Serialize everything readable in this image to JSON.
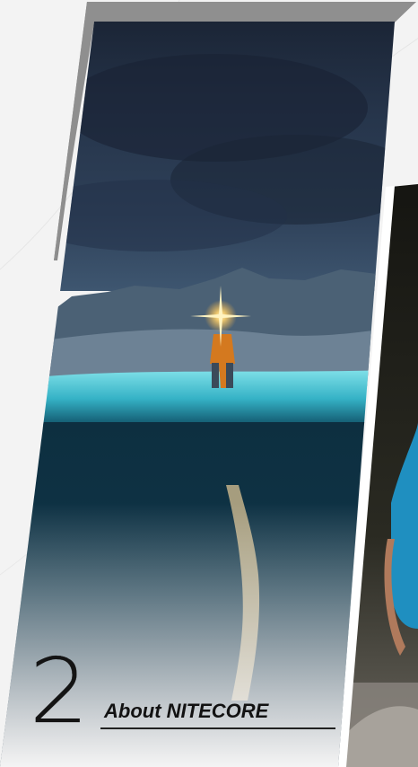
{
  "section": {
    "number": "2",
    "title": "About NITECORE"
  },
  "images": {
    "left_panel": "night-lake-headlamp-photo",
    "right_panel": "runner-portrait-photo"
  },
  "colors": {
    "background": "#f3f3f3",
    "shadow_block": "#8a8a8a",
    "sky": "#1e2c3f",
    "water_glow": "#3fb6c6",
    "shirt": "#1f8fc0",
    "text": "#121212"
  }
}
